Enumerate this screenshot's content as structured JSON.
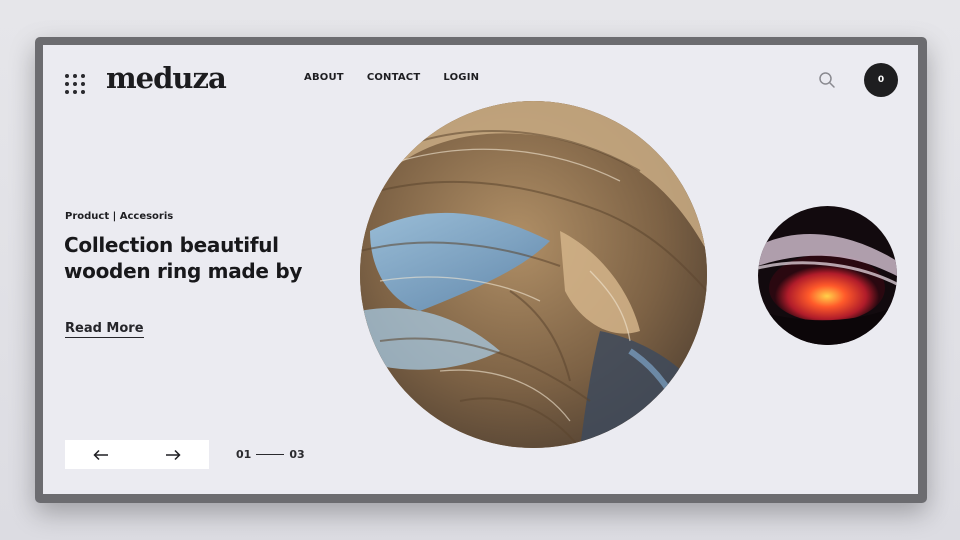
{
  "brand": {
    "name": "meduza"
  },
  "nav": {
    "items": [
      "ABOUT",
      "CONTACT",
      "LOGIN"
    ]
  },
  "icons": {
    "menu": "grid-menu-icon",
    "search": "search-icon",
    "prev": "arrow-left-icon",
    "next": "arrow-right-icon"
  },
  "cart": {
    "count": "0"
  },
  "hero": {
    "category": "Product | Accesoris",
    "headline_line1": "Collection beautiful",
    "headline_line2": "wooden ring made by",
    "cta": "Read More"
  },
  "pager": {
    "current": "01",
    "total": "03"
  },
  "colors": {
    "background": "#ebebf1",
    "text": "#1c1c1f",
    "frame": "#6c6c70",
    "cart": "#1e1e20"
  }
}
